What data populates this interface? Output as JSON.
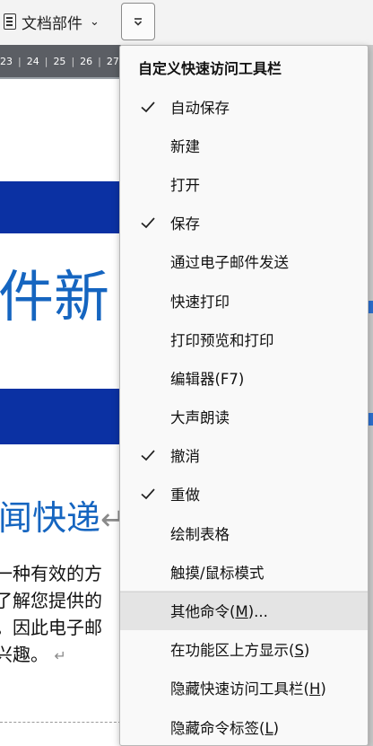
{
  "ribbon": {
    "doc_parts_label": "文档部件"
  },
  "ruler": {
    "numbers": [
      "23",
      "24",
      "25",
      "26",
      "27"
    ]
  },
  "document": {
    "headline": "件新",
    "subheading": "闻快递",
    "return_mark": "↵",
    "body_lines": [
      "一种有效的方",
      "了解您提供的",
      "。因此电子邮",
      "兴趣。"
    ]
  },
  "menu": {
    "title": "自定义快速访问工具栏",
    "items": [
      {
        "label": "自动保存",
        "checked": true
      },
      {
        "label": "新建",
        "checked": false
      },
      {
        "label": "打开",
        "checked": false
      },
      {
        "label": "保存",
        "checked": true
      },
      {
        "label": "通过电子邮件发送",
        "checked": false
      },
      {
        "label": "快速打印",
        "checked": false
      },
      {
        "label": "打印预览和打印",
        "checked": false
      },
      {
        "label": "编辑器(F7)",
        "checked": false
      },
      {
        "label": "大声朗读",
        "checked": false
      },
      {
        "label": "撤消",
        "checked": true
      },
      {
        "label": "重做",
        "checked": true
      },
      {
        "label": "绘制表格",
        "checked": false
      },
      {
        "label": "触摸/鼠标模式",
        "checked": false
      },
      {
        "label": "其他命令(M)...",
        "checked": false
      },
      {
        "label": "在功能区上方显示(S)",
        "checked": false
      },
      {
        "label": "隐藏快速访问工具栏(H)",
        "checked": false
      },
      {
        "label": "隐藏命令标签(L)",
        "checked": false
      }
    ]
  },
  "colors": {
    "accent_blue": "#0b31a3",
    "heading_blue": "#1565c0",
    "menu_bg": "#f9f9f9",
    "hover_bg": "#e4e4e4"
  }
}
